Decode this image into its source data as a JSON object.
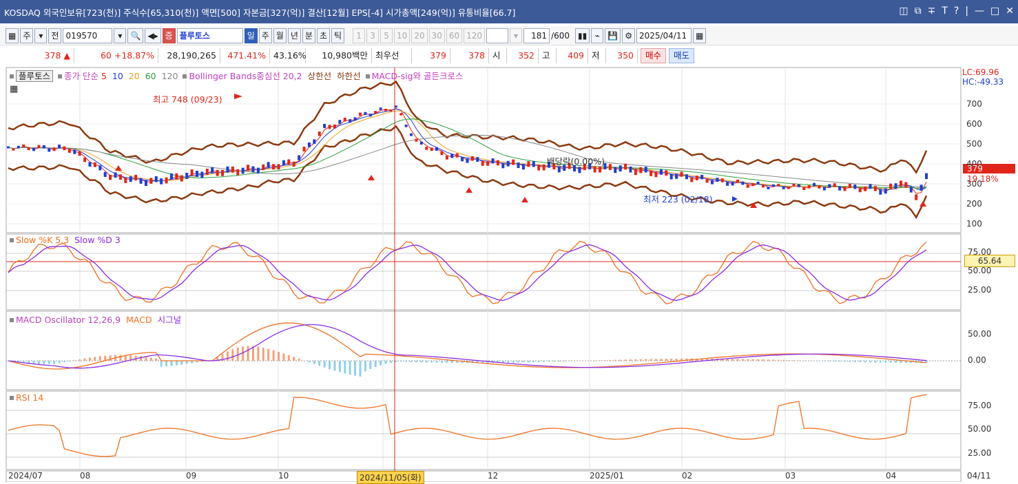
{
  "title": "KOSDAQ 외국인보유[723(천)] 주식수[65,310(천)] 액면[500] 자본금[327(억)] 결산[12월] EPS[-4] 시가총액[249(억)] 유통비율[66.7]",
  "window_controls": [
    "◫",
    "⧉",
    "∓",
    "T",
    "?",
    "|",
    "—",
    "□",
    "✕"
  ],
  "toolbar": {
    "market_label": "주",
    "all_label": "전",
    "code": "019570",
    "badge": "증",
    "name": "플루토스",
    "periods": [
      "일",
      "주",
      "월",
      "년",
      "분",
      "초",
      "틱"
    ],
    "intervals": [
      "1",
      "3",
      "5",
      "10",
      "20",
      "30",
      "60",
      "120"
    ],
    "count": "181",
    "total": "/600",
    "date": "2025/04/11"
  },
  "quote": {
    "price": "378",
    "change": "60",
    "pct": "+18.87%",
    "volume": "28,190,265",
    "vol_ratio": "471.41%",
    "turnover": "43.16%",
    "amount": "10,980백만",
    "best_label": "최우선",
    "best_ask": "379",
    "best_bid": "378",
    "open_label": "시",
    "open": "352",
    "high_label": "고",
    "high": "409",
    "low_label": "저",
    "low": "350",
    "buy": "매수",
    "sell": "매도"
  },
  "price_panel": {
    "name_chip": "플루토스",
    "ma_label": "종가 단순",
    "ma_periods": [
      "5",
      "10",
      "20",
      "60",
      "120"
    ],
    "ma_colors": [
      "#e0261b",
      "#1f3fd0",
      "#f0a020",
      "#2a9d3a",
      "#888888"
    ],
    "bb_label": "Bollinger Bands중심선 20,2",
    "bb_upper": "상한선",
    "bb_lower": "하한선",
    "macd_sig": "MACD-sig와 골든크로스",
    "lc": "LC:69.96",
    "hc": "HC:-49.33",
    "high_mark": "최고 748 (09/23)",
    "low_mark": "최저 223 (02/18)",
    "dividend": "배당락(0.00%)",
    "cur_price": "379",
    "cur_pct": "19.18%",
    "yticks": [
      "700",
      "600",
      "500",
      "400",
      "300",
      "200",
      "100"
    ]
  },
  "stoch_panel": {
    "label": "Slow %K 5,3",
    "label2": "Slow %D 3",
    "value": "65.64",
    "yticks": [
      "75.00",
      "50.00",
      "25.00"
    ]
  },
  "macd_panel": {
    "label": "MACD Oscillator 12,26,9",
    "label2": "MACD",
    "label3": "시그널",
    "yticks": [
      "50.00",
      "0.00"
    ]
  },
  "rsi_panel": {
    "label": "RSI 14",
    "yticks": [
      "75.00",
      "50.00",
      "25.00"
    ]
  },
  "xaxis": {
    "labels": [
      "2024/07",
      "08",
      "09",
      "10",
      "12",
      "2025/01",
      "02",
      "03",
      "04"
    ],
    "selected": "2024/11/05(화)",
    "right": "04/11"
  }
}
